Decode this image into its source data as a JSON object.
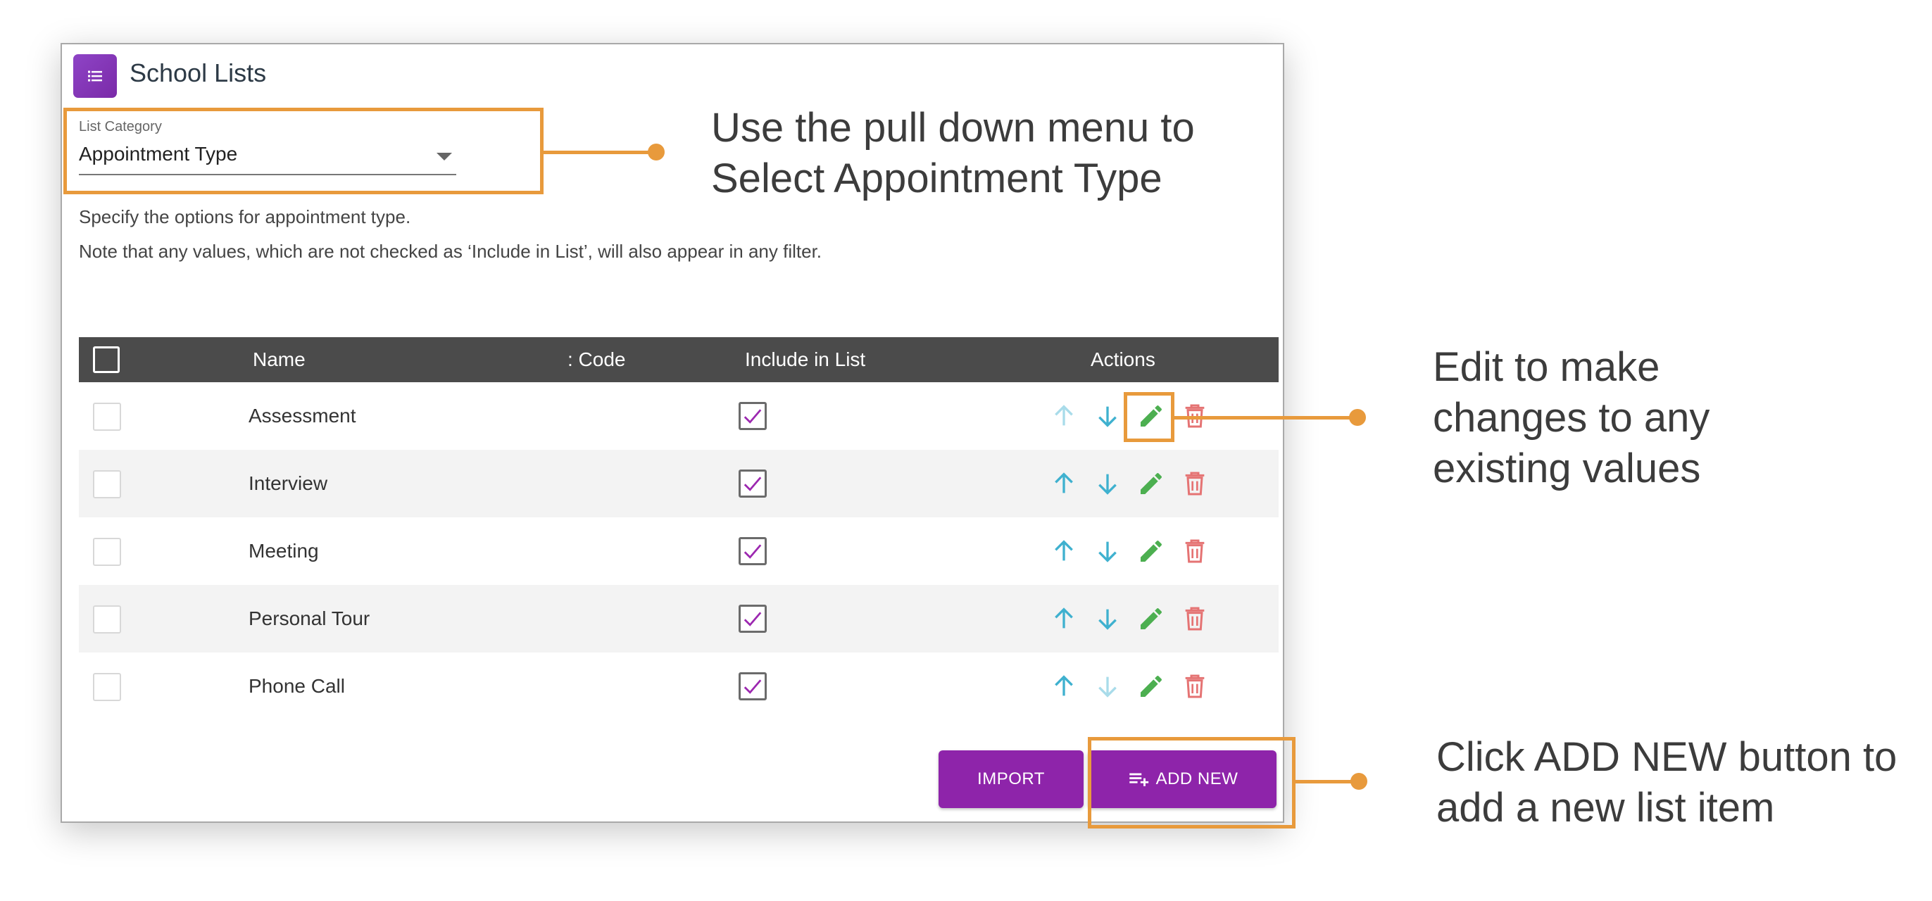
{
  "app": {
    "title": "School Lists"
  },
  "category": {
    "label": "List Category",
    "value": "Appointment Type"
  },
  "description": {
    "line1": "Specify the options for appointment type.",
    "line2": "Note that any values, which are not checked as ‘Include in List’, will also appear in any filter."
  },
  "table": {
    "headers": {
      "name": "Name",
      "code": ": Code",
      "include": "Include in List",
      "actions": "Actions"
    },
    "rows": [
      {
        "name": "Assessment",
        "included": true
      },
      {
        "name": "Interview",
        "included": true
      },
      {
        "name": "Meeting",
        "included": true
      },
      {
        "name": "Personal Tour",
        "included": true
      },
      {
        "name": "Phone Call",
        "included": true
      }
    ]
  },
  "buttons": {
    "import": "IMPORT",
    "add_new": "ADD NEW"
  },
  "annotations": {
    "category_line1": "Use the pull down menu to",
    "category_line2": "Select Appointment Type",
    "edit_line1": "Edit to make",
    "edit_line2": "changes to any",
    "edit_line3": "existing values",
    "add_line1": "Click ADD NEW button to",
    "add_line2": "add a new list item"
  },
  "colors": {
    "accent": "#8e24aa",
    "annotation": "#e89a3c",
    "arrow": "#3fb1cf",
    "edit": "#4caf50",
    "delete": "#e57373"
  }
}
